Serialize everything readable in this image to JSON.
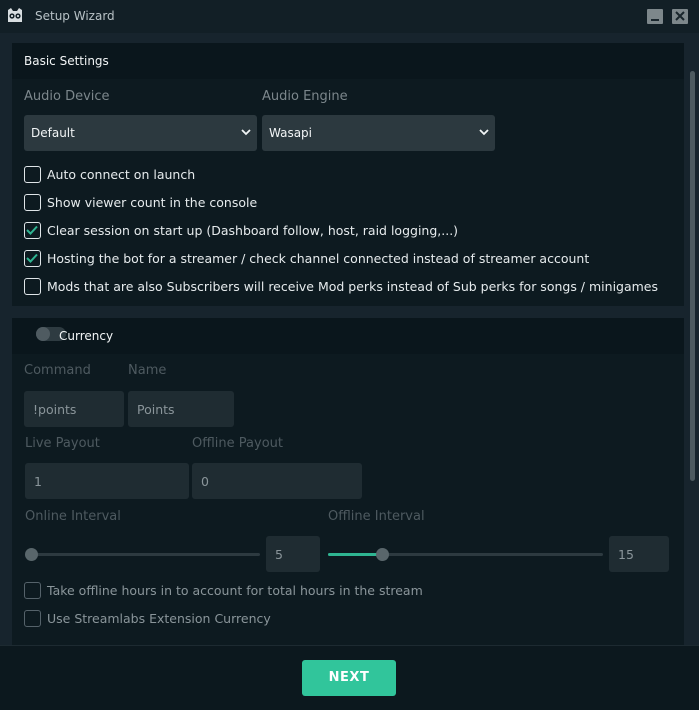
{
  "window": {
    "title": "Setup Wizard",
    "icon": "owl-bot-icon"
  },
  "basic_settings": {
    "title": "Basic Settings",
    "audio_device": {
      "label": "Audio Device",
      "selected": "Default"
    },
    "audio_engine": {
      "label": "Audio Engine",
      "selected": "Wasapi"
    },
    "options": [
      {
        "label": "Auto connect on launch",
        "checked": false
      },
      {
        "label": "Show viewer count in the console",
        "checked": false
      },
      {
        "label": "Clear session on start up (Dashboard follow, host, raid logging,...)",
        "checked": true
      },
      {
        "label": "Hosting the bot for a streamer / check channel connected instead of streamer account",
        "checked": true
      },
      {
        "label": "Mods that are also Subscribers will receive Mod perks instead of Sub perks for songs / minigames",
        "checked": false
      }
    ]
  },
  "currency": {
    "title": "Currency",
    "enabled": false,
    "command": {
      "label": "Command",
      "value": "!points"
    },
    "name": {
      "label": "Name",
      "value": "Points"
    },
    "live_payout": {
      "label": "Live Payout",
      "value": "1"
    },
    "offline_payout": {
      "label": "Offline Payout",
      "value": "0"
    },
    "online_interval": {
      "label": "Online Interval",
      "value": "5",
      "slider_fraction": 0.0
    },
    "offline_interval": {
      "label": "Offline Interval",
      "value": "15",
      "slider_fraction": 0.2
    },
    "options": [
      {
        "label": "Take offline hours in to account for total hours in the stream",
        "checked": false
      },
      {
        "label": "Use Streamlabs Extension Currency",
        "checked": false
      }
    ]
  },
  "footer": {
    "next_label": "NEXT"
  },
  "colors": {
    "accent": "#31c59b",
    "background": "#17242d",
    "panel": "#0d1a20"
  }
}
